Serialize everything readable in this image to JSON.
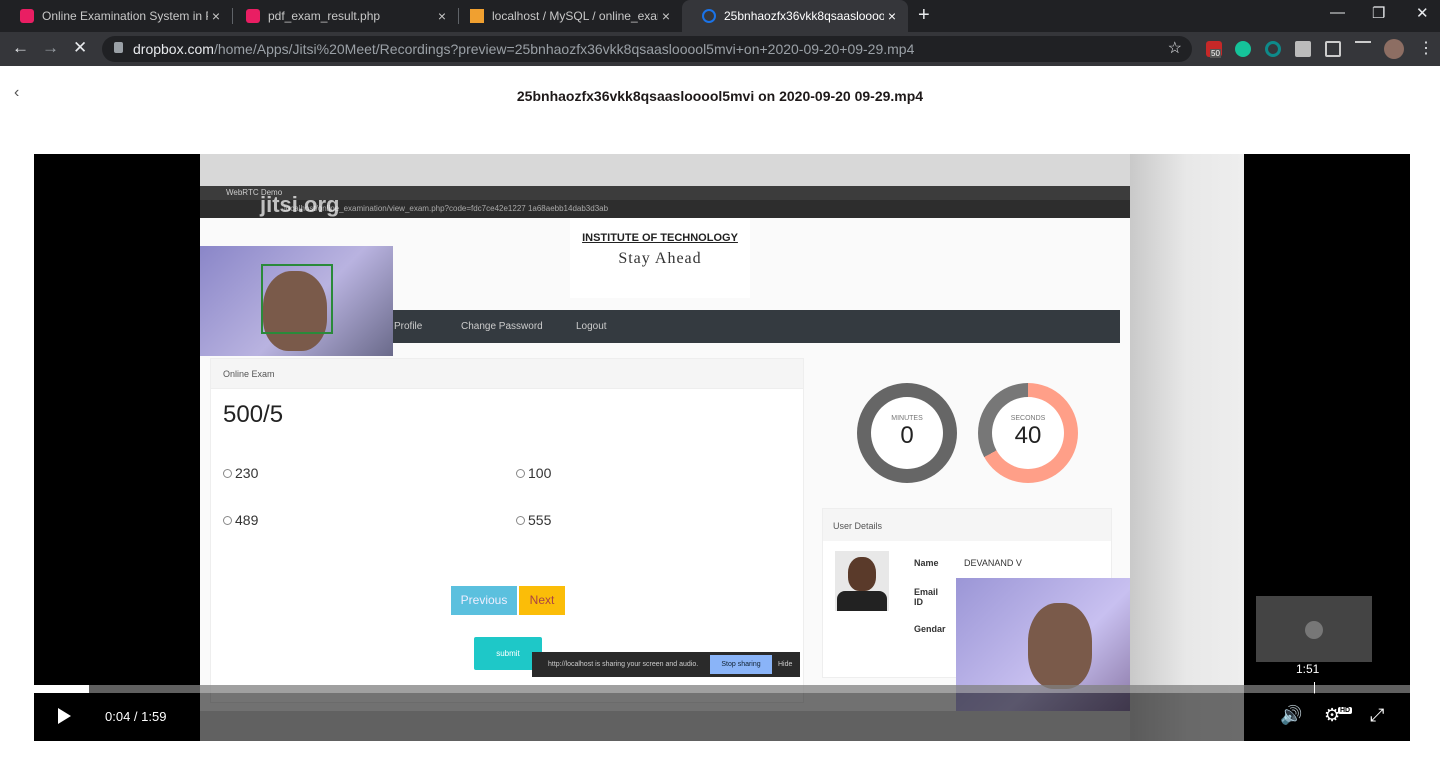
{
  "browser": {
    "tabs": [
      {
        "title": "Online Examination System in PHP",
        "favicon_color": "#e91e63"
      },
      {
        "title": "pdf_exam_result.php",
        "favicon_color": "#e91e63"
      },
      {
        "title": "localhost / MySQL / online_exam",
        "favicon_color": "#f0a030"
      },
      {
        "title": "25bnhaozfx36vkk8qsaaslooool5mvi",
        "favicon_color": "#1a73e8"
      }
    ],
    "close_glyph": "×",
    "new_tab_glyph": "+",
    "window_controls": [
      "—",
      "❐",
      "✕"
    ],
    "nav": {
      "back": "←",
      "forward": "→",
      "stop": "✕"
    },
    "url_domain": "dropbox.com",
    "url_path": "/home/Apps/Jitsi%20Meet/Recordings?preview=25bnhaozfx36vkk8qsaaslooool5mvi+on+2020-09-20+09-29.mp4",
    "extension_badge": "50",
    "menu_glyph": "⋮"
  },
  "dropbox": {
    "back_glyph": "‹",
    "file_title": "25bnhaozfx36vkk8qsaaslooool5mvi on 2020-09-20 09-29.mp4"
  },
  "video": {
    "watermark": "jitsi.org",
    "inner_tab": "WebRTC Demo",
    "inner_url": "localhost/online_examination/view_exam.php?code=fdc7ce42e1227 1a68aebb14dab3d3ab",
    "institute": "INSTITUTE OF TECHNOLOGY",
    "tagline": "Stay Ahead",
    "menu": [
      "Profile",
      "Change Password",
      "Logout"
    ],
    "exam_header": "Online Exam",
    "question": "500/5",
    "options": [
      "230",
      "100",
      "489",
      "555"
    ],
    "previous_label": "Previous",
    "next_label": "Next",
    "submit_label": "submit",
    "share_message": "http://localhost is sharing your screen and audio.",
    "stop_sharing_label": "Stop sharing",
    "hide_label": "Hide",
    "timer": {
      "minutes_label": "MINUTES",
      "minutes": "0",
      "seconds_label": "SECONDS",
      "seconds": "40",
      "seconds_fraction": 0.67
    },
    "user_details_header": "User Details",
    "user_labels": [
      "Name",
      "Email ID",
      "Gendar"
    ],
    "user_name": "DEVANAND V"
  },
  "player": {
    "current_time": "0:04",
    "separator": " / ",
    "duration": "1:59",
    "hover_time": "1:51",
    "progress_fraction": 0.04,
    "hd_badge": "HD",
    "volume_glyph": "🔊",
    "settings_glyph": "⚙",
    "fullscreen_glyph": "⤢"
  }
}
